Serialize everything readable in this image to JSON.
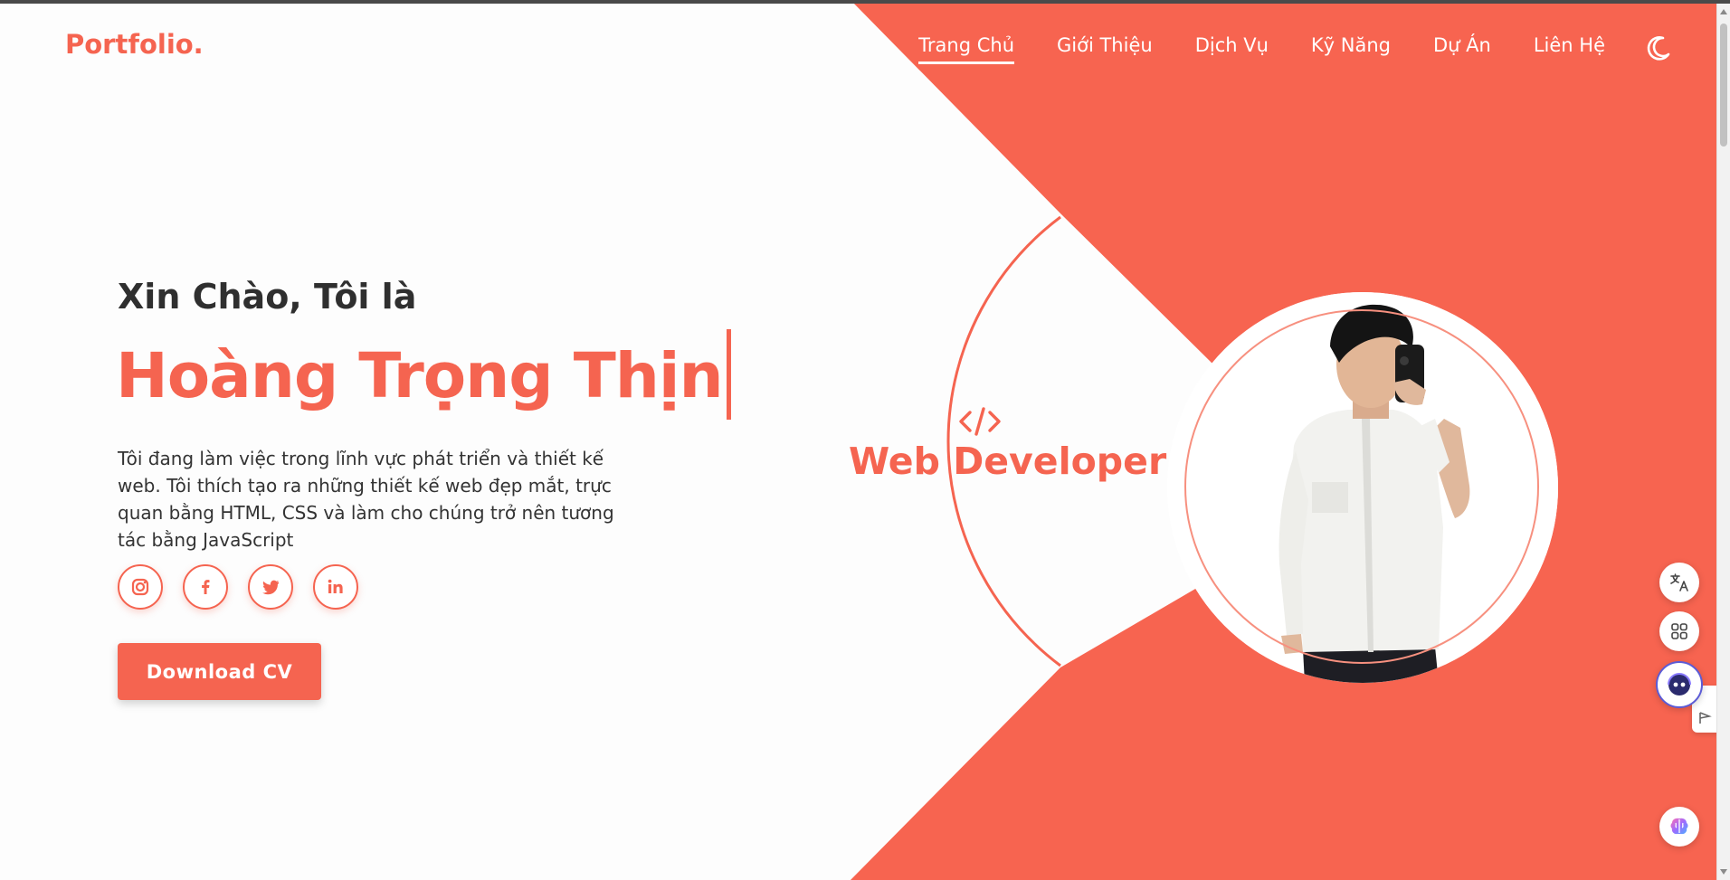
{
  "colors": {
    "accent": "#f56450",
    "accent_light": "#f7907f",
    "text_dark": "#2f2f2f",
    "background": "#fdfdfd"
  },
  "header": {
    "logo": "Portfolio.",
    "nav": [
      {
        "label": "Trang Chủ",
        "active": true
      },
      {
        "label": "Giới Thiệu",
        "active": false
      },
      {
        "label": "Dịch Vụ",
        "active": false
      },
      {
        "label": "Kỹ Năng",
        "active": false
      },
      {
        "label": "Dự Án",
        "active": false
      },
      {
        "label": "Liên Hệ",
        "active": false
      }
    ],
    "theme_icon": "moon-icon"
  },
  "hero": {
    "greeting": "Xin Chào, Tôi là",
    "name": "Hoàng Trọng Thịn",
    "intro": "Tôi đang làm việc trong lĩnh vực phát triển và thiết kế web. Tôi thích tạo ra những thiết kế web đẹp mắt, trực quan bằng HTML, CSS và làm cho chúng trở nên tương tác bằng JavaScript",
    "socials": [
      "instagram-icon",
      "facebook-icon",
      "twitter-icon",
      "linkedin-icon"
    ],
    "cta_label": "Download CV",
    "role_icon": "code-icon",
    "role": "Web Developer",
    "photo": "profile-photo"
  },
  "floating_widgets": [
    "translate-icon",
    "apps-grid-icon",
    "assistant-bot-icon",
    "brain-icon"
  ]
}
